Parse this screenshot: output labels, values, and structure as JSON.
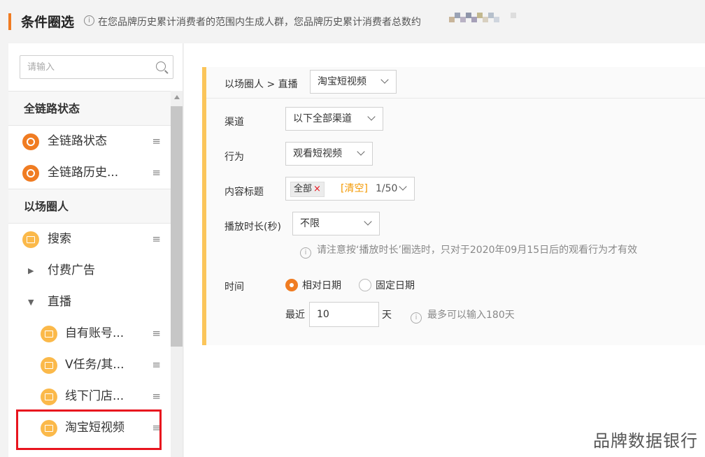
{
  "header": {
    "title": "条件圈选",
    "info_glyph": "i",
    "description": "在您品牌历史累计消费者的范围内生成人群，您品牌历史累计消费者总数约"
  },
  "sidebar": {
    "search_placeholder": "请输入",
    "groups": [
      {
        "title": "全链路状态",
        "items": [
          {
            "label": "全链路状态",
            "icon": "lifecycle-icon"
          },
          {
            "label": "全链路历史...",
            "icon": "lifecycle-icon"
          }
        ]
      },
      {
        "title": "以场圈人",
        "items": [
          {
            "label": "搜索",
            "icon": "scene-icon"
          },
          {
            "label": "付费广告",
            "expand": "collapsed"
          },
          {
            "label": "直播",
            "expand": "expanded"
          },
          {
            "label": "自有账号...",
            "icon": "scene-icon"
          },
          {
            "label": "V任务/其...",
            "icon": "scene-icon"
          },
          {
            "label": "线下门店...",
            "icon": "scene-icon"
          },
          {
            "label": "淘宝短视频",
            "icon": "scene-icon",
            "selected": true
          }
        ]
      }
    ],
    "drag_glyph": "≡"
  },
  "main": {
    "breadcrumb": "以场圈人 > 直播",
    "scene_select": "淘宝短视频",
    "fields": {
      "channel": {
        "label": "渠道",
        "value": "以下全部渠道"
      },
      "behavior": {
        "label": "行为",
        "value": "观看短视频"
      },
      "content_title": {
        "label": "内容标题",
        "tag": "全部",
        "tag_close": "×",
        "clear": "[清空]",
        "count": "1/50"
      },
      "duration": {
        "label": "播放时长(秒)",
        "value": "不限",
        "note": "请注意按‘播放时长’圈选时，只对于2020年09月15日后的观看行为才有效"
      },
      "time": {
        "label": "时间",
        "options": [
          "相对日期",
          "固定日期"
        ],
        "selected": 0,
        "recent_label": "最近",
        "recent_value": "10",
        "unit": "天",
        "limit_note": "最多可以输入180天"
      }
    },
    "info_glyph": "i"
  },
  "watermark": "品牌数据银行",
  "colors": {
    "accent": "#f07c22",
    "highlight": "#e8141e",
    "card_border": "#fbc55a",
    "clear_link": "#f39800"
  }
}
